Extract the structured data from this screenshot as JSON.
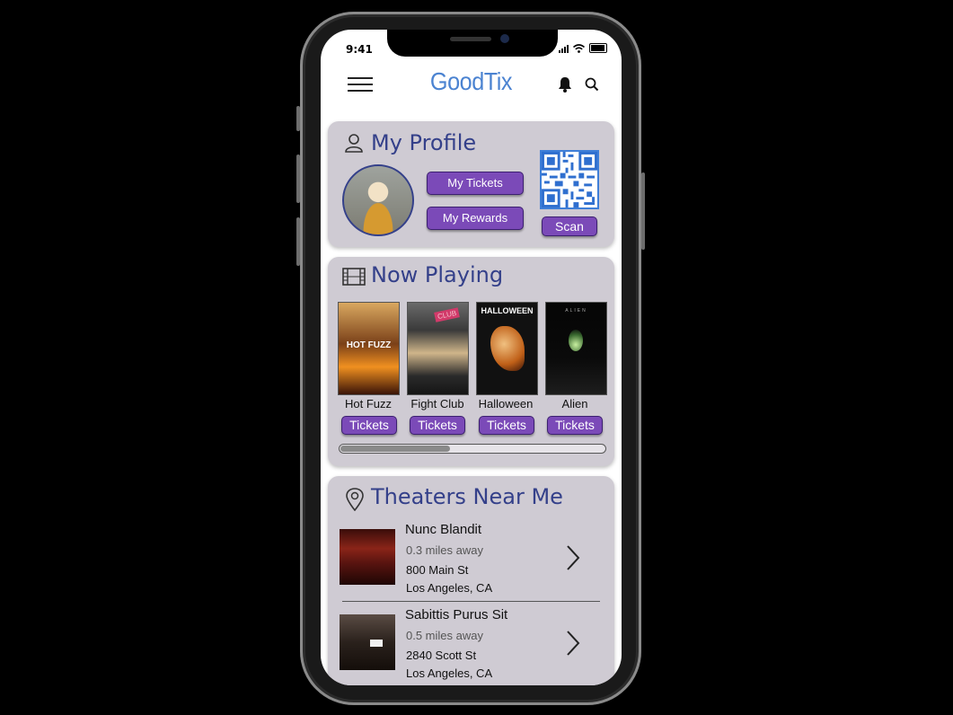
{
  "status": {
    "time": "9:41"
  },
  "app": {
    "title": "GoodTix"
  },
  "profile": {
    "title": "My Profile",
    "my_tickets": "My Tickets",
    "my_rewards": "My Rewards",
    "scan": "Scan"
  },
  "now_playing": {
    "title": "Now Playing",
    "movies": [
      {
        "title": "Hot Fuzz",
        "button": "Tickets"
      },
      {
        "title": "Fight Club",
        "button": "Tickets"
      },
      {
        "title": "Halloween",
        "button": "Tickets"
      },
      {
        "title": "Alien",
        "button": "Tickets"
      }
    ],
    "posters": [
      "HOT FUZZ",
      "CLUB",
      "HALLOWEEN",
      "ALIEN"
    ]
  },
  "theaters": {
    "title": "Theaters Near Me",
    "items": [
      {
        "name": "Nunc Blandit",
        "distance": "0.3 miles away",
        "street": "800 Main St",
        "city": "Los Angeles, CA"
      },
      {
        "name": "Sabittis Purus Sit",
        "distance": "0.5 miles away",
        "street": "2840 Scott St",
        "city": "Los Angeles, CA"
      }
    ]
  },
  "colors": {
    "accent": "#7b4ab8",
    "title": "#34408a",
    "brand": "#4b83d1",
    "card": "#cfcbd3"
  },
  "icons": [
    "menu-icon",
    "bell-icon",
    "search-icon",
    "user-icon",
    "film-icon",
    "map-pin-icon",
    "chevron-right-icon",
    "qr-code-icon"
  ]
}
